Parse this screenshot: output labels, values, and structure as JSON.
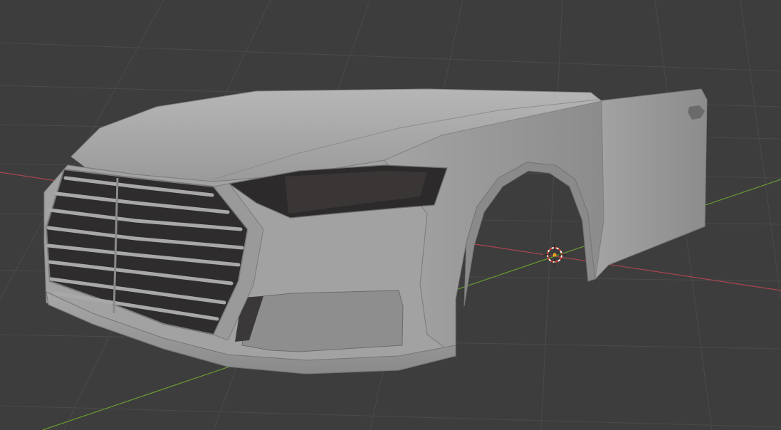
{
  "app": "3D Viewport",
  "viewport": {
    "background_color": "#3d3d3d",
    "grid_color": "#4a4a4a",
    "x_axis_color": "#a8464f",
    "y_axis_color": "#6a9a31"
  },
  "scene": {
    "object": "car-front-body-mesh",
    "shading": "solid",
    "body_color": "#9e9e9e",
    "body_highlight_color": "#b8b8b8",
    "body_shadow_color": "#6e6e6e",
    "interior_color": "#2c2a2a"
  },
  "cursor": {
    "icon": "3d-cursor-icon",
    "ring_color": "#ffffff",
    "accent_color": "#d63b2e",
    "origin_color": "#f0a020"
  }
}
